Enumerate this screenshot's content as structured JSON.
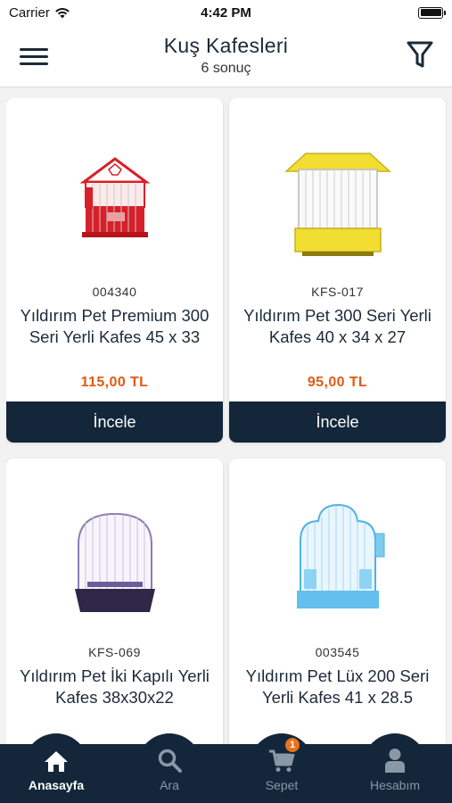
{
  "status": {
    "carrier": "Carrier",
    "time": "4:42 PM"
  },
  "header": {
    "title": "Kuş Kafesleri",
    "subtitle": "6 sonuç"
  },
  "products": [
    {
      "sku": "004340",
      "name": "Yıldırım Pet Premium 300 Seri Yerli Kafes 45 x 33",
      "price": "115,00 TL",
      "button": "İncele"
    },
    {
      "sku": "KFS-017",
      "name": "Yıldırım Pet 300 Seri Yerli Kafes 40 x 34 x 27",
      "price": "95,00 TL",
      "button": "İncele"
    },
    {
      "sku": "KFS-069",
      "name": "Yıldırım Pet İki Kapılı Yerli Kafes 38x30x22"
    },
    {
      "sku": "003545",
      "name": "Yıldırım Pet Lüx 200 Seri Yerli Kafes 41 x 28.5"
    }
  ],
  "tabs": [
    {
      "label": "Anasayfa",
      "icon": "home-icon",
      "active": true
    },
    {
      "label": "Ara",
      "icon": "search-icon"
    },
    {
      "label": "Sepet",
      "icon": "cart-icon",
      "badge": "1"
    },
    {
      "label": "Hesabım",
      "icon": "user-icon"
    }
  ],
  "colors": {
    "navy": "#13263a",
    "price": "#e35a12",
    "badge": "#e8731a"
  }
}
